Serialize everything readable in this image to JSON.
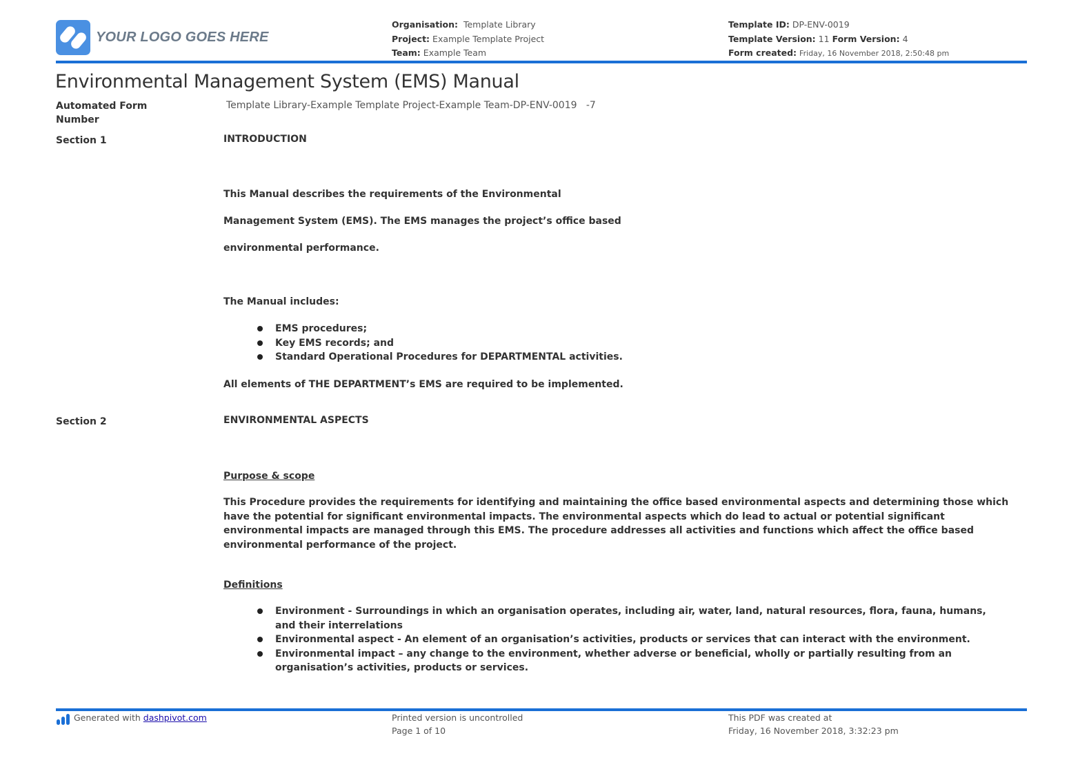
{
  "header": {
    "logo_text": "YOUR LOGO GOES HERE",
    "organisation_label": "Organisation:",
    "organisation_value": "Template Library",
    "project_label": "Project:",
    "project_value": "Example Template Project",
    "team_label": "Team:",
    "team_value": "Example Team",
    "template_id_label": "Template ID:",
    "template_id_value": "DP-ENV-0019",
    "template_version_label": "Template Version:",
    "template_version_value": "11",
    "form_version_label": "Form Version:",
    "form_version_value": "4",
    "form_created_label": "Form created:",
    "form_created_value": "Friday, 16 November 2018, 2:50:48 pm",
    "accent_color": "#1a6fd6"
  },
  "document": {
    "title": "Environmental Management System (EMS) Manual",
    "form_number_label": "Automated Form Number",
    "form_number_value": "Template Library-Example Template Project-Example Team-DP-ENV-0019   -7",
    "sections": [
      {
        "label": "Section 1",
        "heading": "INTRODUCTION",
        "intro_lines": [
          "This Manual describes the requirements of the Environmental",
          "Management System (EMS). The EMS manages the project’s office based",
          "environmental performance."
        ],
        "includes_label": "The Manual includes:",
        "includes": [
          "EMS procedures;",
          "Key EMS records; and",
          "Standard Operational Procedures for DEPARTMENTAL activities."
        ],
        "closing": "All elements of THE DEPARTMENT’s EMS are required to be implemented."
      },
      {
        "label": "Section 2",
        "heading": "ENVIRONMENTAL ASPECTS",
        "purpose_heading": "Purpose & scope",
        "purpose_text": "This Procedure provides the requirements for identifying and maintaining the office based environmental aspects and determining those which have the potential for significant environmental impacts. The environmental aspects which do lead to actual or potential significant environmental impacts are managed through this EMS. The procedure addresses all activities and functions which affect the office based environmental performance of the project.",
        "definitions_heading": "Definitions",
        "definitions": [
          "Environment - Surroundings in which an organisation operates, including air, water, land, natural resources, flora, fauna, humans, and their interrelations",
          "Environmental aspect - An element of an organisation’s activities, products or services that can interact with the environment.",
          "Environmental impact – any change to the environment, whether adverse or beneficial, wholly or partially resulting from an organisation’s activities, products or services."
        ]
      }
    ]
  },
  "footer": {
    "generated_prefix": "Generated with ",
    "generated_link": "dashpivot.com",
    "uncontrolled": "Printed version is uncontrolled",
    "page_info": "Page 1 of 10",
    "pdf_created_label": "This PDF was created at",
    "pdf_created_value": "Friday, 16 November 2018, 3:32:23 pm"
  }
}
